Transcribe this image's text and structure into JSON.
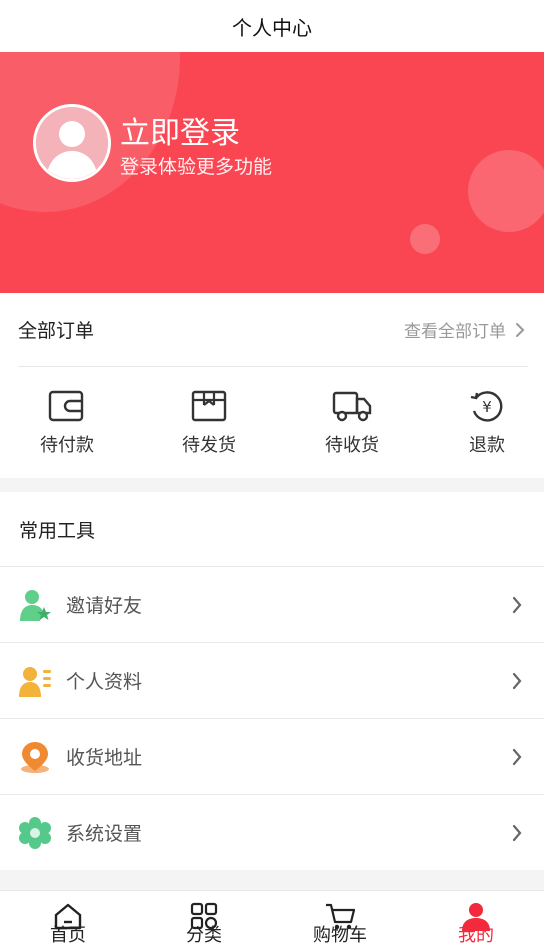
{
  "nav": {
    "title": "个人中心"
  },
  "profile": {
    "login_title": "立即登录",
    "login_subtitle": "登录体验更多功能"
  },
  "orders": {
    "title": "全部订单",
    "view_all": "查看全部订单",
    "items": [
      {
        "label": "待付款",
        "icon": "wallet-icon"
      },
      {
        "label": "待发货",
        "icon": "package-icon"
      },
      {
        "label": "待收货",
        "icon": "truck-icon"
      },
      {
        "label": "退款",
        "icon": "refund-icon"
      }
    ]
  },
  "tools": {
    "title": "常用工具",
    "items": [
      {
        "label": "邀请好友",
        "icon": "invite-friend-icon",
        "color": "#5fcf8a"
      },
      {
        "label": "个人资料",
        "icon": "profile-card-icon",
        "color": "#f3b23a"
      },
      {
        "label": "收货地址",
        "icon": "location-pin-icon",
        "color": "#f08a32"
      },
      {
        "label": "系统设置",
        "icon": "settings-gear-icon",
        "color": "#55c98b"
      }
    ]
  },
  "tabbar": {
    "items": [
      {
        "label": "首页",
        "icon": "home-icon",
        "active": false
      },
      {
        "label": "分类",
        "icon": "category-icon",
        "active": false
      },
      {
        "label": "购物车",
        "icon": "cart-icon",
        "active": false
      },
      {
        "label": "我的",
        "icon": "user-icon",
        "active": true
      }
    ]
  },
  "colors": {
    "brand": "#f94652",
    "active_tab": "#f22a3c"
  }
}
